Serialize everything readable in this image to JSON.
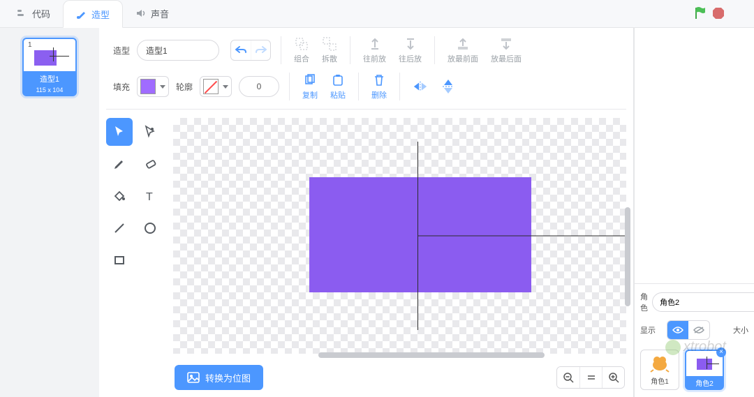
{
  "tabs": {
    "code": "代码",
    "costumes": "造型",
    "sounds": "声音"
  },
  "costume_list": [
    {
      "num": "1",
      "name": "造型1",
      "dim": "115 x 104"
    }
  ],
  "row1": {
    "costume_label": "造型",
    "name_value": "造型1",
    "group": "组合",
    "ungroup": "拆散",
    "forward": "往前放",
    "backward": "往后放",
    "front": "放最前面",
    "back": "放最后面"
  },
  "row2": {
    "fill_label": "填充",
    "outline_label": "轮廓",
    "outline_value": "0",
    "copy": "复制",
    "paste": "粘贴",
    "delete": "删除",
    "fill_color": "#a06cff"
  },
  "tools": {
    "select": "select",
    "reshape": "reshape",
    "brush": "brush",
    "eraser": "eraser",
    "fill": "fill",
    "text": "text",
    "line": "line",
    "circle": "circle",
    "rect": "rect"
  },
  "bottom": {
    "convert": "转换为位图"
  },
  "rightpane": {
    "sprite_label": "角色",
    "sprite_name": "角色2",
    "show_label": "显示",
    "size_label": "大小",
    "sprite1": "角色1",
    "sprite2": "角色2"
  },
  "watermark": "xtrobot"
}
